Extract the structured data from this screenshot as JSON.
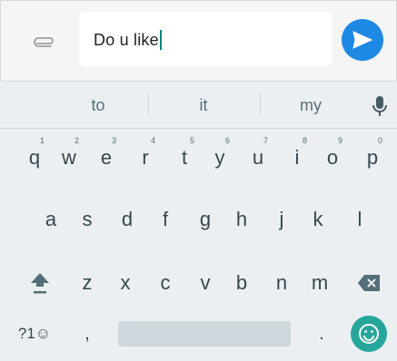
{
  "composer": {
    "input_value": "Do u like"
  },
  "suggestions": [
    "to",
    "it",
    "my"
  ],
  "keyboard": {
    "row1": [
      {
        "k": "q",
        "n": "1"
      },
      {
        "k": "w",
        "n": "2"
      },
      {
        "k": "e",
        "n": "3"
      },
      {
        "k": "r",
        "n": "4"
      },
      {
        "k": "t",
        "n": "5"
      },
      {
        "k": "y",
        "n": "6"
      },
      {
        "k": "u",
        "n": "7"
      },
      {
        "k": "i",
        "n": "8"
      },
      {
        "k": "o",
        "n": "9"
      },
      {
        "k": "p",
        "n": "0"
      }
    ],
    "row2": [
      "a",
      "s",
      "d",
      "f",
      "g",
      "h",
      "j",
      "k",
      "l"
    ],
    "row3": [
      "z",
      "x",
      "c",
      "v",
      "b",
      "n",
      "m"
    ],
    "symbols_label": "?1☺",
    "comma": ",",
    "period": "."
  },
  "colors": {
    "accent_send": "#1e88e5",
    "accent_emoji": "#26a69a",
    "cursor": "#00897b"
  },
  "icons": {
    "attach": "paperclip-icon",
    "send": "send-icon",
    "mic": "microphone-icon",
    "shift": "shift-icon",
    "backspace": "backspace-icon",
    "emoji": "emoji-icon"
  }
}
